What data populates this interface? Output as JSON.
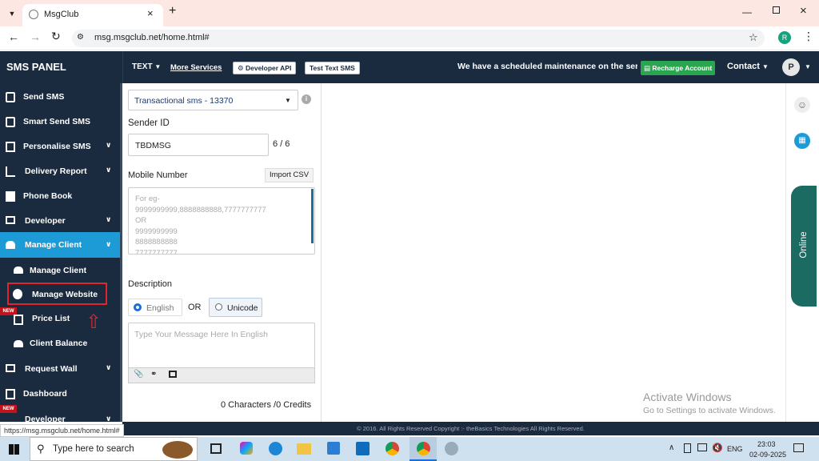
{
  "browser": {
    "tab_title": "MsgClub",
    "new_tab_symbol": "+",
    "url": "msg.msgclub.net/home.html#",
    "profile_initial": "R",
    "status_url": "https://msg.msgclub.net/home.html#"
  },
  "header": {
    "brand": "SMS PANEL",
    "text_menu": "TEXT",
    "more_services": "More Services",
    "developer_api": "Developer API",
    "test_text_sms": "Test Text SMS",
    "marquee": "We have a scheduled maintenance on the serve",
    "recharge": "Recharge Account",
    "contact": "Contact",
    "user_initial": "P"
  },
  "sidebar": {
    "items": [
      {
        "label": "Send SMS",
        "icon": "phone-icon"
      },
      {
        "label": "Smart Send SMS",
        "icon": "phone-icon"
      },
      {
        "label": "Personalise SMS",
        "icon": "person-card-icon"
      },
      {
        "label": "Delivery Report",
        "icon": "line-chart-icon"
      },
      {
        "label": "Phone Book",
        "icon": "book-icon"
      },
      {
        "label": "Developer",
        "icon": "monitor-icon"
      },
      {
        "label": "Manage Client",
        "icon": "users-icon"
      },
      {
        "label": "Manage Client",
        "icon": "users-icon"
      },
      {
        "label": "Manage Website",
        "icon": "globe-icon"
      },
      {
        "label": "Price List",
        "icon": "document-icon"
      },
      {
        "label": "Client Balance",
        "icon": "users-icon"
      },
      {
        "label": "Request Wall",
        "icon": "monitor-icon"
      },
      {
        "label": "Dashboard",
        "icon": "document-icon"
      },
      {
        "label": "Developer",
        "icon": "monitor-icon"
      }
    ],
    "new_badge": "NEW"
  },
  "form": {
    "route_select": "Transactional sms - 13370",
    "sender_label": "Sender ID",
    "sender_value": "TBDMSG",
    "sender_count": "6 / 6",
    "mobile_label": "Mobile Number",
    "import_csv": "Import CSV",
    "mobile_placeholder": "For eg-\n9999999999,8888888888,7777777777\nOR\n9999999999\n8888888888\n7777777777",
    "description_label": "Description",
    "english": "English",
    "or": "OR",
    "unicode": "Unicode",
    "message_placeholder": "Type Your Message Here In English",
    "counter": "0 Characters /0 Credits"
  },
  "right_rail": {
    "online": "Online"
  },
  "watermark": {
    "title": "Activate Windows",
    "subtitle": "Go to Settings to activate Windows."
  },
  "footer": {
    "copyright": "© 2016. All Rights Reserved Copyright :- theBasics Technologies All Rights Reserved."
  },
  "taskbar": {
    "search": "Type here to search",
    "lang": "ENG",
    "time": "23:03",
    "date": "02-09-2025"
  },
  "colors": {
    "nav_bg": "#1a2b3f",
    "accent": "#1c9bd7",
    "recharge": "#2aa650",
    "online": "#1b6b63",
    "badge": "#c0151d",
    "tabbar": "#fde7e3"
  }
}
